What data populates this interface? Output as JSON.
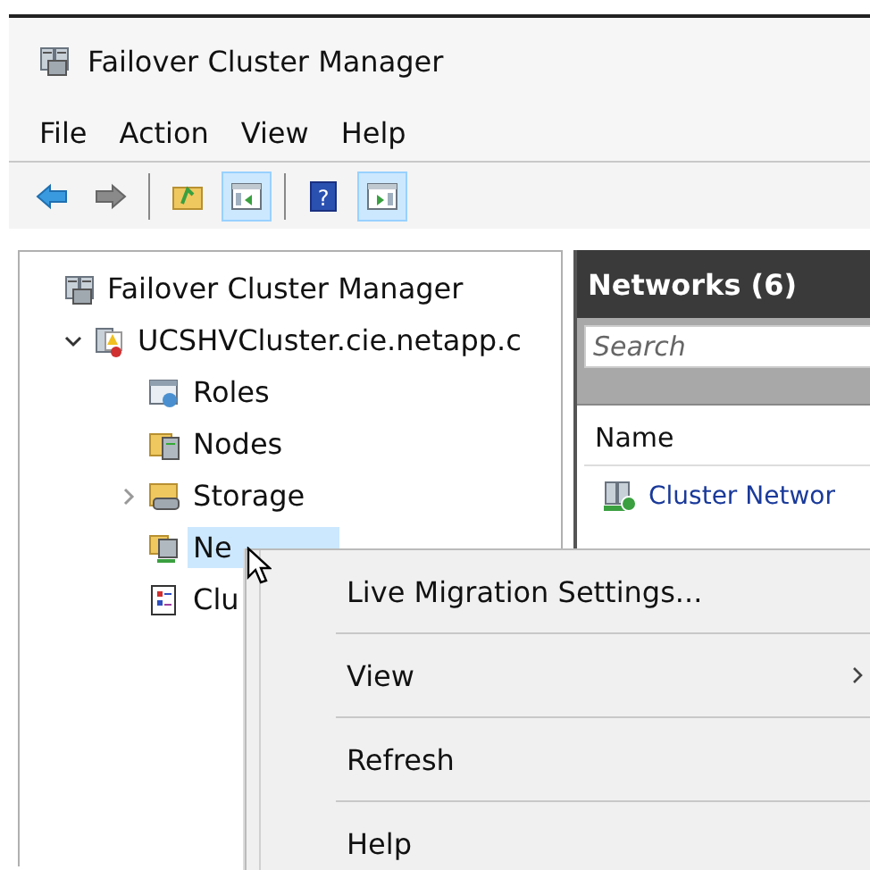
{
  "window": {
    "title": "Failover Cluster Manager"
  },
  "menu": [
    "File",
    "Action",
    "View",
    "Help"
  ],
  "toolbar": [
    {
      "kind": "back",
      "pressed": false
    },
    {
      "kind": "forward",
      "pressed": false
    },
    {
      "kind": "separator"
    },
    {
      "kind": "up",
      "pressed": false
    },
    {
      "kind": "tree",
      "pressed": true
    },
    {
      "kind": "separator"
    },
    {
      "kind": "help",
      "pressed": false,
      "glyph": "?"
    },
    {
      "kind": "action",
      "pressed": true
    }
  ],
  "tree": [
    {
      "label": "Failover Cluster Manager",
      "selected": false,
      "children": [
        {
          "label": "UCSHVCluster.cie.netapp.c",
          "selected": false,
          "expanded": true,
          "children": [
            {
              "label": "Roles",
              "selected": false
            },
            {
              "label": "Nodes",
              "selected": false
            },
            {
              "label": "Storage",
              "selected": false,
              "expanded": false
            },
            {
              "label": "Ne",
              "selected": true
            },
            {
              "label": "Clu",
              "selected": false
            }
          ]
        }
      ]
    }
  ],
  "panel": {
    "title": "Networks (6)",
    "search": {
      "placeholder": "Search"
    },
    "columns": [
      "Name"
    ],
    "rows": [
      {
        "name": "Cluster Networ"
      }
    ]
  },
  "context_menu": [
    {
      "label": "Live Migration Settings...",
      "submenu": false
    },
    {
      "label": "View",
      "submenu": true
    },
    {
      "label": "Refresh",
      "submenu": false
    },
    {
      "label": "Help",
      "submenu": false
    }
  ]
}
